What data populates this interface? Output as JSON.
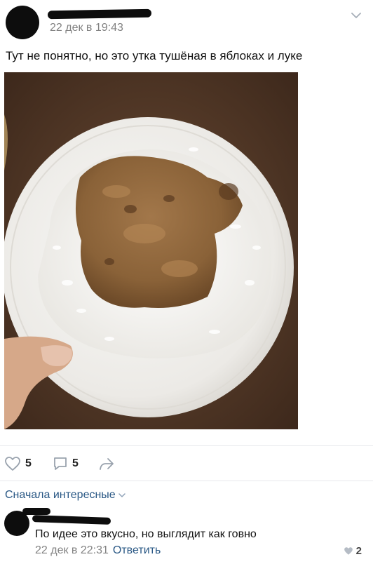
{
  "post": {
    "date": "22 дек в 19:43",
    "text": "Тут не понятно, но это утка тушёная в яблоках и луке"
  },
  "actions": {
    "likes": "5",
    "comments": "5"
  },
  "comments_section": {
    "sort_label": "Сначала интересные"
  },
  "comment": {
    "text": "По идее это вкусно, но выглядит как говно",
    "date": "22 дек в 22:31",
    "reply_label": "Ответить",
    "likes": "2"
  },
  "colors": {
    "link": "#2a5885",
    "meta": "#828282",
    "divider": "#e7e8ec"
  }
}
